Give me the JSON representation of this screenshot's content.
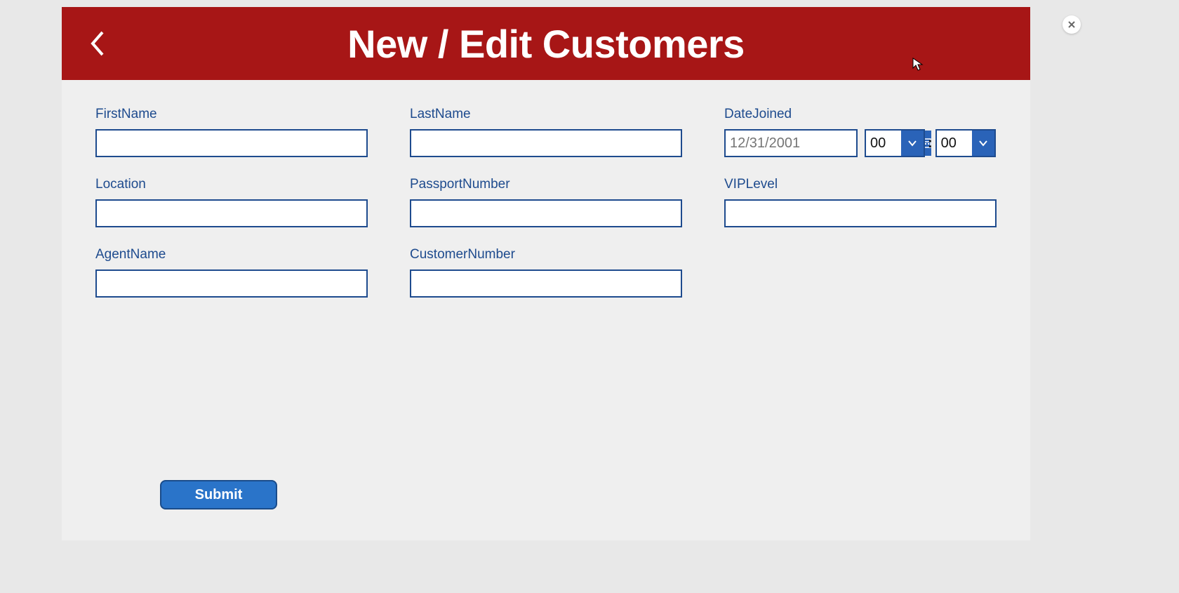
{
  "header": {
    "title": "New / Edit Customers"
  },
  "fields": {
    "firstName": {
      "label": "FirstName",
      "value": ""
    },
    "lastName": {
      "label": "LastName",
      "value": ""
    },
    "dateJoined": {
      "label": "DateJoined",
      "placeholder": "12/31/2001",
      "hours": "00",
      "minutes": "00"
    },
    "location": {
      "label": "Location",
      "value": ""
    },
    "passportNumber": {
      "label": "PassportNumber",
      "value": ""
    },
    "vipLevel": {
      "label": "VIPLevel",
      "value": ""
    },
    "agentName": {
      "label": "AgentName",
      "value": ""
    },
    "customerNumber": {
      "label": "CustomerNumber",
      "value": ""
    }
  },
  "actions": {
    "submit": "Submit"
  },
  "colors": {
    "headerBg": "#a71616",
    "accent": "#1e4b8e",
    "buttonBg": "#2a74c9"
  }
}
